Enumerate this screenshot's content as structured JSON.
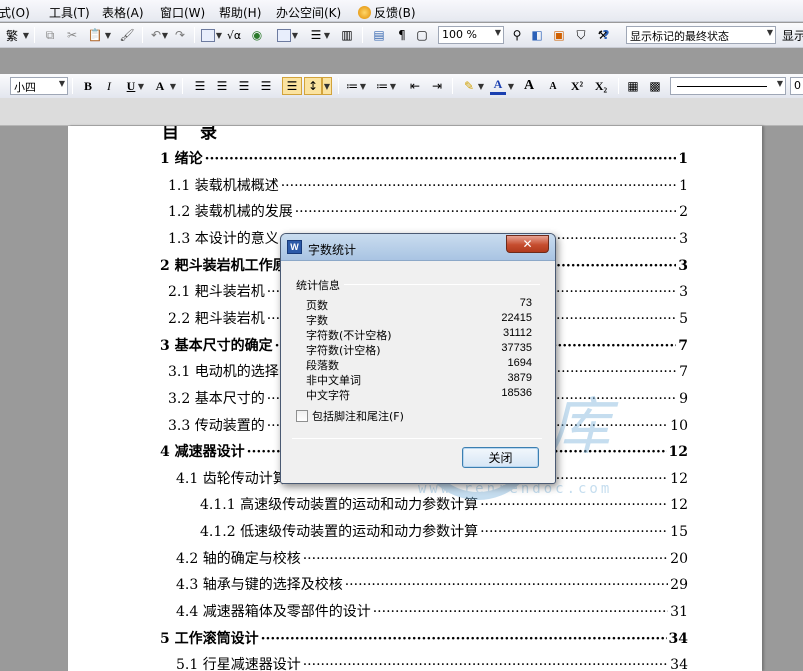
{
  "menubar": {
    "items": [
      "式(O)",
      "工具(T)",
      "表格(A)",
      "窗口(W)",
      "帮助(H)",
      "办公空间(K)",
      "反馈(B)"
    ]
  },
  "toolbar1": {
    "traditional_label": "繁",
    "zoom_value": "100 %",
    "markup_state_value": "显示标记的最终状态",
    "show_label": "显示"
  },
  "toolbar2": {
    "font_size_value": "小四",
    "bold_label": "B",
    "italic_label": "I",
    "underline_label": "U",
    "font_color_label": "A",
    "grow_font_label": "A",
    "shrink_font_label": "A",
    "superscript_label": "X²",
    "subscript_label": "X₂",
    "trailing_value": "0"
  },
  "document": {
    "toc_title": "目　录",
    "toc": [
      {
        "text": "1 绪论",
        "page": "1",
        "level": 1
      },
      {
        "text": "1.1 装载机械概述",
        "page": "1",
        "level": 2
      },
      {
        "text": "1.2 装载机械的发展",
        "page": "2",
        "level": 2
      },
      {
        "text": "1.3  本设计的意义",
        "page": "3",
        "level": 2
      },
      {
        "text": "2 耙斗装岩机工作原理",
        "page": "3",
        "level": 1
      },
      {
        "text": "2.1 耙斗装岩机",
        "page": "3",
        "level": 2
      },
      {
        "text": "2.2 耙斗装岩机",
        "page": "5",
        "level": 2
      },
      {
        "text": "3  基本尺寸的确定",
        "page": "7",
        "level": 1
      },
      {
        "text": "3.1  电动机的选择",
        "page": "7",
        "level": 2
      },
      {
        "text": "3.2  基本尺寸的",
        "page": "9",
        "level": 2
      },
      {
        "text": "3.3  传动装置的",
        "page": "10",
        "level": 2
      },
      {
        "text": "4  减速器设计",
        "page": "12",
        "level": 1
      },
      {
        "text": "4.1 齿轮传动计算",
        "page": "12",
        "level": 2
      },
      {
        "text": "4.1.1 高速级传动装置的运动和动力参数计算",
        "page": "12",
        "level": 3
      },
      {
        "text": "4.1.2 低速级传动装置的运动和动力参数计算",
        "page": "15",
        "level": 3
      },
      {
        "text": "4.2 轴的确定与校核",
        "page": "20",
        "level": 2
      },
      {
        "text": "4.3 轴承与键的选择及校核",
        "page": "29",
        "level": 2
      },
      {
        "text": "4.4 减速器箱体及零部件的设计",
        "page": "31",
        "level": 2
      },
      {
        "text": "5  工作滚筒设计",
        "page": "34",
        "level": 1
      },
      {
        "text": "5.1  行星减速器设计",
        "page": "34",
        "level": 2
      }
    ]
  },
  "watermark": {
    "chars": [
      "人",
      "文",
      "库"
    ],
    "url": "www.renrendoc.com"
  },
  "dialog": {
    "app_icon_letter": "W",
    "title": "字数统计",
    "close_x": "✕",
    "section_label": "统计信息",
    "stats": [
      {
        "label": "页数",
        "value": "73"
      },
      {
        "label": "字数",
        "value": "22415"
      },
      {
        "label": "字符数(不计空格)",
        "value": "31112"
      },
      {
        "label": "字符数(计空格)",
        "value": "37735"
      },
      {
        "label": "段落数",
        "value": "1694"
      },
      {
        "label": "非中文单词",
        "value": "3879"
      },
      {
        "label": "中文字符",
        "value": "18536"
      }
    ],
    "footnote_label": "包括脚注和尾注(F)",
    "close_button_label": "关闭"
  }
}
